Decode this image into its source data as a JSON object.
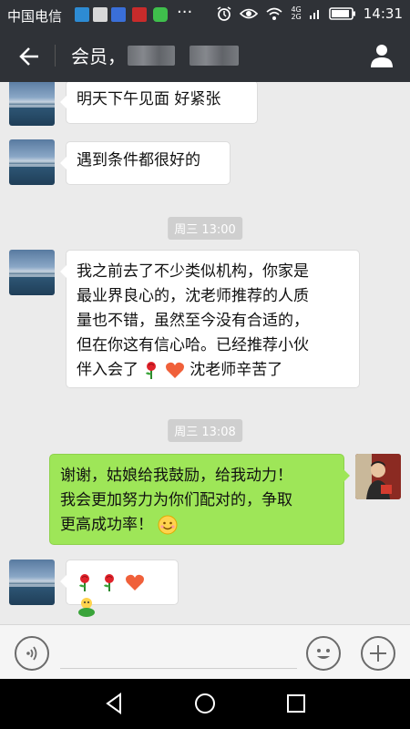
{
  "status_bar": {
    "carrier": "中国电信",
    "time": "14:31",
    "network_top": "4G",
    "network_bottom": "2G"
  },
  "top_bar": {
    "title": "会员，",
    "icons": {
      "back": "back-arrow-icon",
      "profile": "person-icon"
    }
  },
  "messages": [
    {
      "side": "left",
      "text": "明天下午见面 好紧张"
    },
    {
      "side": "left",
      "text": "遇到条件都很好的"
    },
    {
      "type": "time",
      "text": "周三 13:00"
    },
    {
      "side": "left",
      "lines": [
        "我之前去了不少类似机构，你家是",
        "最业界良心的，沈老师推荐的人质",
        "量也不错，虽然至今没有合适的，",
        "但在你这有信心哈。已经推荐小伙"
      ],
      "last_line_prefix": "伴入会了",
      "last_line_suffix": "沈老师辛苦了",
      "emojis": [
        "rose-emoji",
        "heart-emoji"
      ]
    },
    {
      "type": "time",
      "text": "周三 13:08"
    },
    {
      "side": "right",
      "lines": [
        "谢谢，姑娘给我鼓励，给我动力！",
        "我会更加努力为你们配对的，争取"
      ],
      "last_line": "更高成功率！",
      "emojis": [
        "smile-emoji"
      ]
    },
    {
      "side": "left",
      "emojis": [
        "rose-emoji",
        "rose-emoji",
        "heart-emoji",
        "frog-emoji"
      ]
    }
  ],
  "colors": {
    "header": "#2f3237",
    "chat_bg": "#ebebeb",
    "my_bubble": "#9ee658",
    "time_badge": "#cfcfcf"
  }
}
